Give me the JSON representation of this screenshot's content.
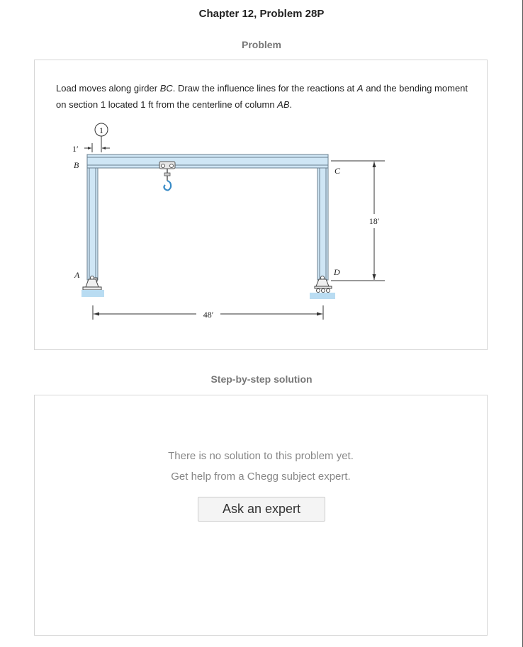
{
  "header": {
    "title": "Chapter 12, Problem 28P"
  },
  "problem": {
    "heading": "Problem",
    "text_1": "Load moves along girder ",
    "text_bc": "BC",
    "text_2": ". Draw the influence lines for the reactions at ",
    "text_a": "A",
    "text_3": " and the bending moment on section 1 located 1 ft from the centerline of column ",
    "text_ab": "AB",
    "text_4": ".",
    "figure": {
      "label_section": "1",
      "label_offset": "1′",
      "label_b": "B",
      "label_c": "C",
      "label_a": "A",
      "label_d": "D",
      "dim_span": "48′",
      "dim_height": "18′"
    }
  },
  "solution": {
    "heading": "Step-by-step solution",
    "no_solution_line1": "There is no solution to this problem yet.",
    "no_solution_line2": "Get help from a Chegg subject expert.",
    "ask_button_label": "Ask an expert"
  },
  "colors": {
    "member_fill": "#cfe6f5",
    "member_stroke": "#6a7f8e",
    "ground_fill": "#b9dcf2",
    "dim_stroke": "#333333"
  }
}
